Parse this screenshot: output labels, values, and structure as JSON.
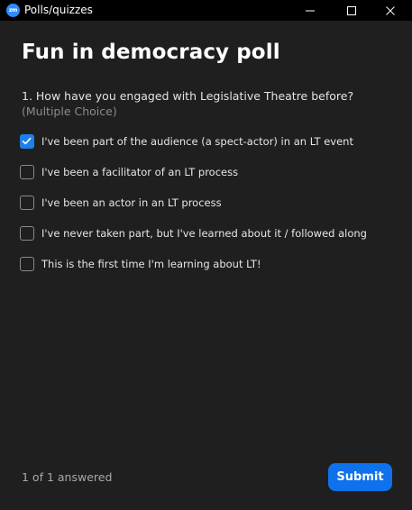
{
  "window": {
    "logo_text": "zm",
    "title": "Polls/quizzes",
    "controls": [
      "minimize-icon",
      "maximize-icon",
      "close-icon"
    ]
  },
  "poll": {
    "title": "Fun in democracy poll",
    "question": {
      "text": "1. How have you engaged with Legislative Theatre before?",
      "type": "(Multiple Choice)"
    },
    "options": [
      {
        "label": "I've been part of the audience (a spect-actor) in an LT event",
        "checked": true
      },
      {
        "label": "I've been a facilitator of an LT process",
        "checked": false
      },
      {
        "label": "I've been an actor in an LT process",
        "checked": false
      },
      {
        "label": "I've never taken part, but I've learned about it / followed along",
        "checked": false
      },
      {
        "label": "This is the first time I'm learning about LT!",
        "checked": false
      }
    ]
  },
  "footer": {
    "answered_text": "1 of 1 answered",
    "submit_label": "Submit"
  },
  "colors": {
    "accent": "#0e72ed",
    "checkbox_checked": "#1e7fe8",
    "background": "#1f1f1f",
    "titlebar": "#000000"
  }
}
